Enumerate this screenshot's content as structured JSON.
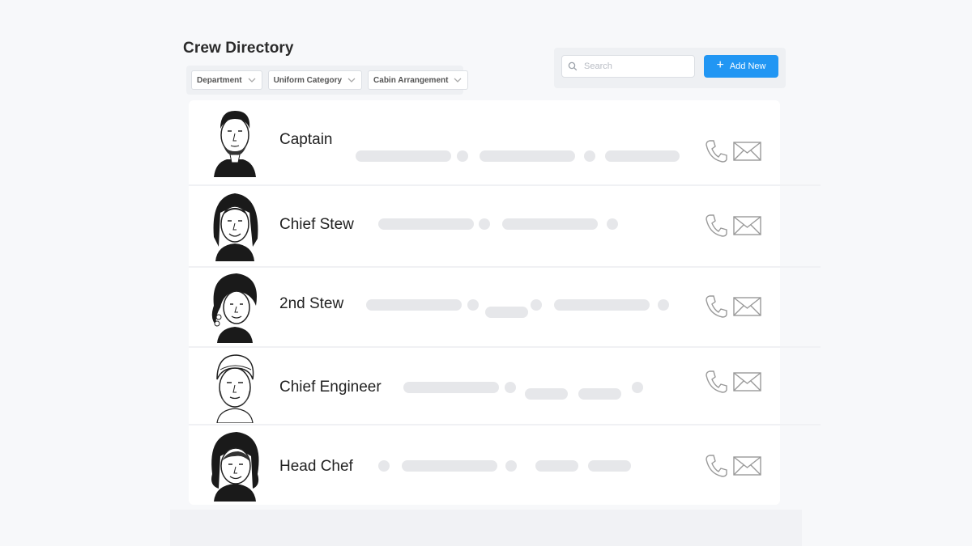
{
  "page": {
    "title": "Crew Directory"
  },
  "filters": [
    {
      "label": "Department"
    },
    {
      "label": "Uniform Category"
    },
    {
      "label": "Cabin Arrangement"
    }
  ],
  "search": {
    "placeholder": "Search",
    "icon": "search-icon"
  },
  "actions": {
    "add_label": "Add New",
    "add_icon": "plus-icon",
    "accent_color": "#2196f3"
  },
  "crew": [
    {
      "role": "Captain",
      "avatar": "captain-avatar"
    },
    {
      "role": "Chief Stew",
      "avatar": "chief-stew-avatar"
    },
    {
      "role": "2nd Stew",
      "avatar": "second-stew-avatar"
    },
    {
      "role": "Chief Engineer",
      "avatar": "chief-engineer-avatar"
    },
    {
      "role": "Head Chef",
      "avatar": "head-chef-avatar"
    }
  ],
  "row_icons": [
    "phone-icon",
    "mail-icon"
  ],
  "colors": {
    "placeholder_bar": "#e6e7ea",
    "background": "#f7f8fa"
  }
}
